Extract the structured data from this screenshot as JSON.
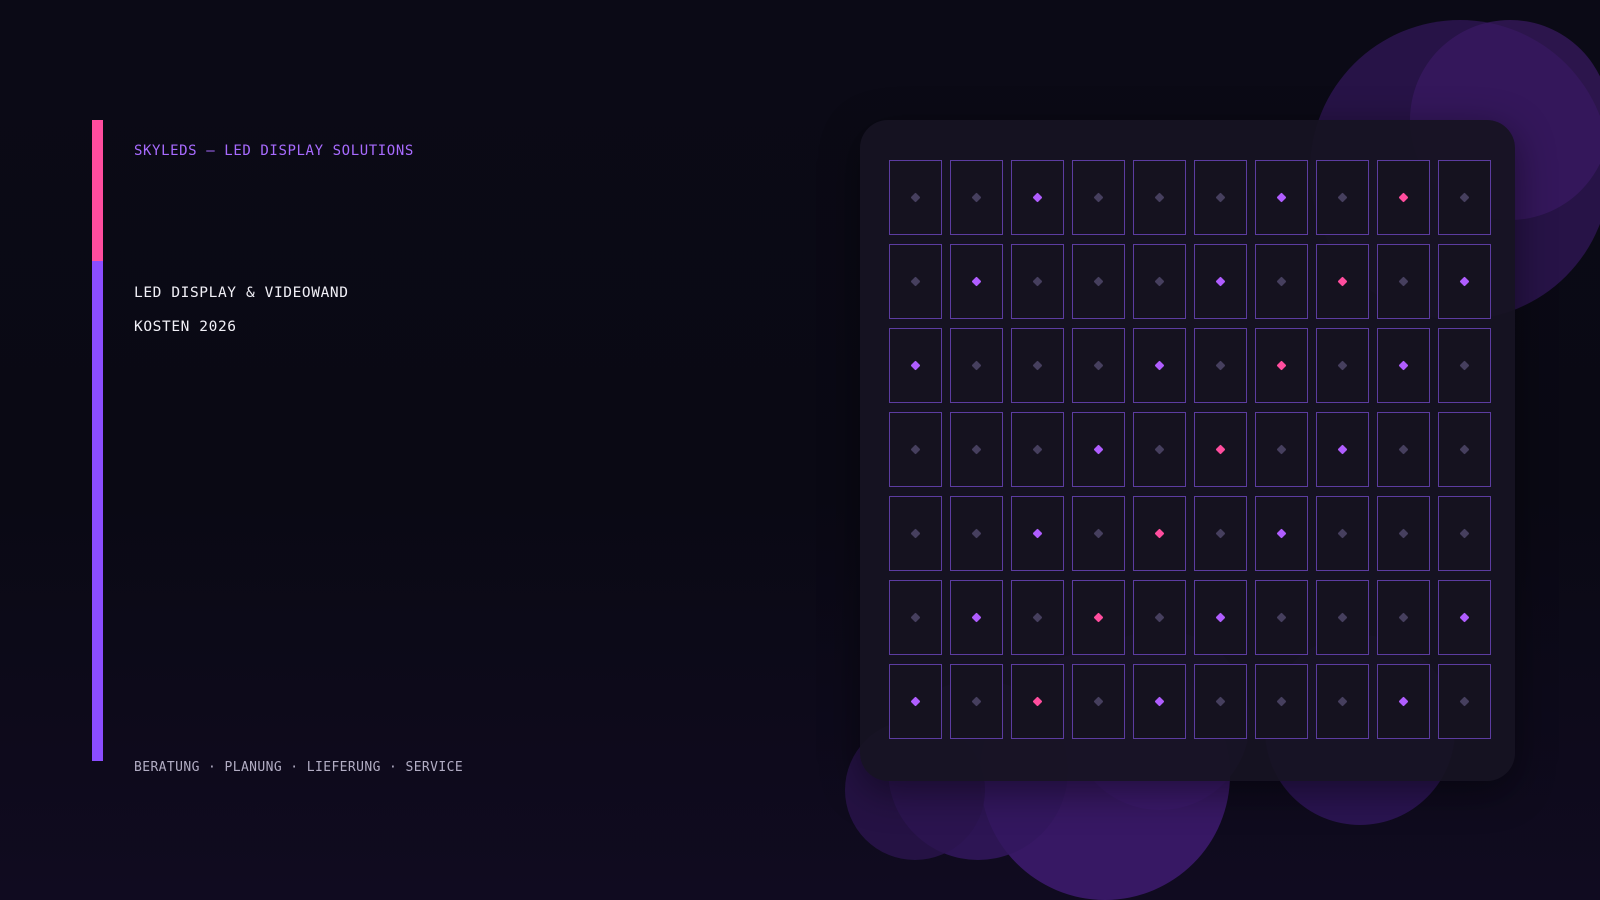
{
  "brand": {
    "line": "SKYLEDS — LED DISPLAY SOLUTIONS"
  },
  "headline": {
    "line1": "LED DISPLAY & VIDEOWAND",
    "line2": "KOSTEN 2026"
  },
  "footer": {
    "line": "BERATUNG · PLANUNG · LIEFERUNG · SERVICE"
  },
  "colors": {
    "background": "#0b0a14",
    "accent_pink": "#ff4d9e",
    "accent_purple": "#8b4dff",
    "led_purple": "#b05dff",
    "led_off": "#463f5e",
    "cell_border": "#5c3ca0"
  },
  "led_grid": {
    "columns": 10,
    "rows": 7,
    "states": [
      [
        "off",
        "off",
        "purple",
        "off",
        "off",
        "off",
        "purple",
        "off",
        "pink",
        "off"
      ],
      [
        "off",
        "purple",
        "off",
        "off",
        "off",
        "purple",
        "off",
        "pink",
        "off",
        "purple"
      ],
      [
        "purple",
        "off",
        "off",
        "off",
        "purple",
        "off",
        "pink",
        "off",
        "purple",
        "off"
      ],
      [
        "off",
        "off",
        "off",
        "purple",
        "off",
        "pink",
        "off",
        "purple",
        "off",
        "off"
      ],
      [
        "off",
        "off",
        "purple",
        "off",
        "pink",
        "off",
        "purple",
        "off",
        "off",
        "off"
      ],
      [
        "off",
        "purple",
        "off",
        "pink",
        "off",
        "purple",
        "off",
        "off",
        "off",
        "purple"
      ],
      [
        "purple",
        "off",
        "pink",
        "off",
        "purple",
        "off",
        "off",
        "off",
        "purple",
        "off"
      ]
    ]
  }
}
